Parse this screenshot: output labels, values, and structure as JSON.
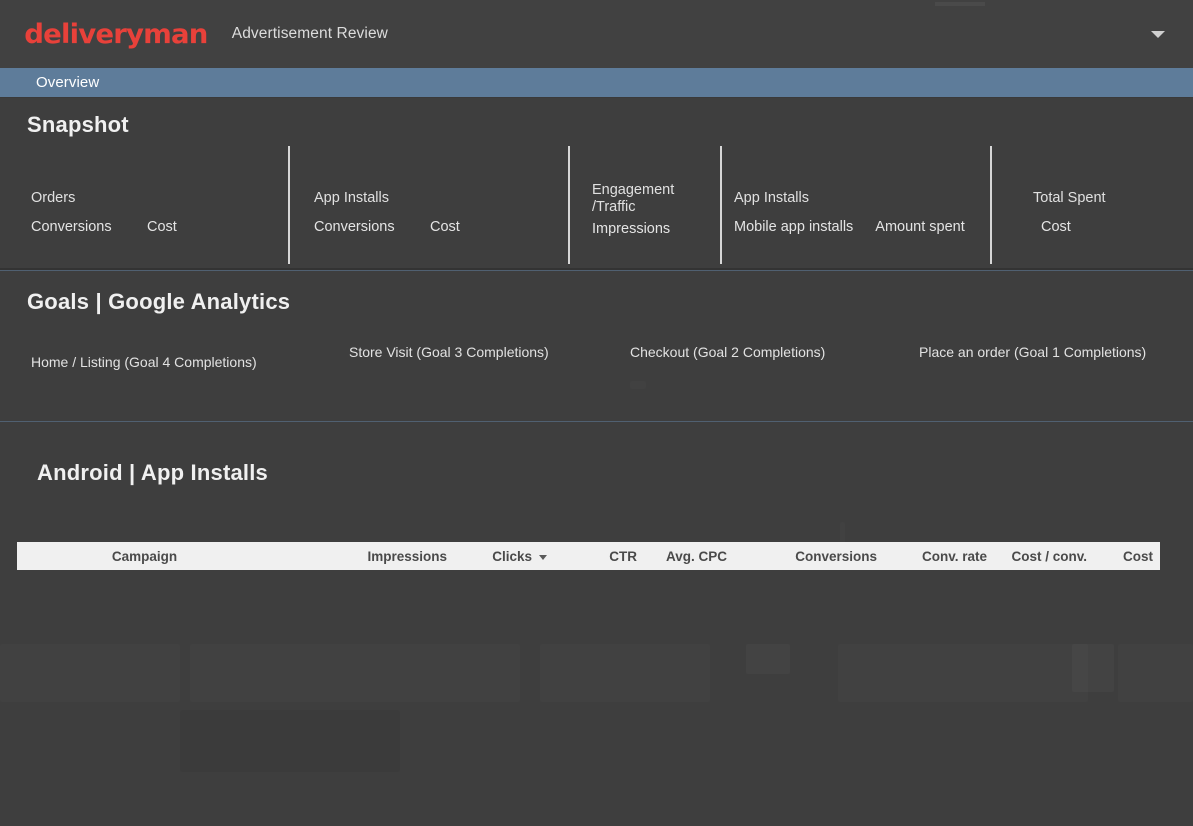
{
  "header": {
    "logo_text": "deliveryman",
    "logo_color": "#e8413a",
    "title": "Advertisement Review",
    "account_caret_icon": "chevron-down-icon"
  },
  "tabbar": {
    "active_tab": "Overview",
    "background_color": "#5e7c9a"
  },
  "snapshot": {
    "title": "Snapshot",
    "groups": [
      {
        "label": "Orders",
        "metrics": [
          "Conversions",
          "Cost"
        ]
      },
      {
        "label": "App Installs",
        "metrics": [
          "Conversions",
          "Cost"
        ]
      },
      {
        "label": "Engagement\n/Traffic",
        "metrics": [
          "Impressions"
        ]
      },
      {
        "label": "App Installs",
        "metrics": [
          "Mobile app installs",
          "Amount spent"
        ]
      },
      {
        "label": "Total Spent",
        "metrics": [
          "Cost"
        ]
      }
    ]
  },
  "goals": {
    "title": "Goals |  Google Analytics",
    "items": [
      "Home / Listing (Goal 4 Completions)",
      "Store Visit (Goal 3 Completions)",
      "Checkout (Goal 2 Completions)",
      "Place an order (Goal 1 Completions)"
    ]
  },
  "android": {
    "title": "Android | App Installs",
    "table": {
      "columns": [
        "Campaign",
        "Impressions",
        "Clicks",
        "CTR",
        "Avg. CPC",
        "Conversions",
        "Conv. rate",
        "Cost / conv.",
        "Cost"
      ],
      "sorted_column": "Clicks",
      "sort_direction": "descending",
      "sort_icon": "caret-down-icon",
      "rows": []
    }
  },
  "colors": {
    "page_background": "#3e3e3e",
    "header_background": "#414141",
    "tab_background": "#5e7c9a",
    "table_header_background": "#f0f0f0",
    "divider": "#d6d6d6"
  }
}
